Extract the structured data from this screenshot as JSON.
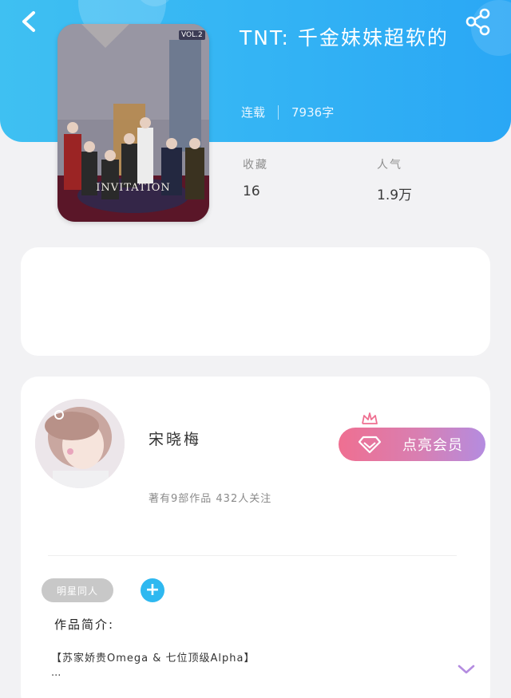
{
  "header": {
    "title": "TNT:  千金妹妹超软的",
    "status": "连载",
    "word_count": "7936字",
    "back_icon": "chevron-left-icon",
    "share_icon": "share-icon",
    "gradient": [
      "#3fc0f2",
      "#2aa7f5"
    ]
  },
  "cover": {
    "text": "INVITATION",
    "vol": "VOL.2"
  },
  "stats": {
    "favorites_label": "收藏",
    "favorites_value": "16",
    "popularity_label": "人气",
    "popularity_value": "1.9万"
  },
  "author": {
    "name": "宋晓梅",
    "meta": "著有9部作品 432人关注",
    "vip_button": "点亮会员",
    "vip_colors": [
      "#ef6f91",
      "#b48ce0"
    ]
  },
  "tags": {
    "items": [
      "明星同人"
    ],
    "add_icon": "plus-icon"
  },
  "intro": {
    "label": "作品简介:",
    "text": "【苏家娇贵Omega & 七位顶级Alpha】",
    "ellipsis": "...",
    "expand_icon": "chevron-down-icon"
  }
}
